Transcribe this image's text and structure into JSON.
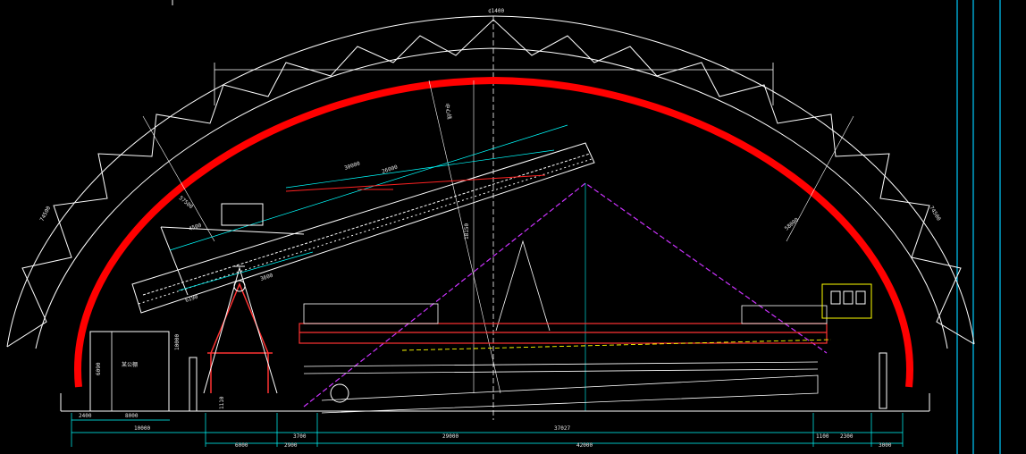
{
  "drawing": {
    "colors": {
      "background": "#000000",
      "roof_arch": "#ff0000",
      "structure": "#ffffff",
      "dimension": "#00ffff",
      "stockpile": "#cc33ff",
      "equipment_detail": "#ff00ff",
      "conveyor_marker": "#ff2222",
      "accent": "#ffff00",
      "frame_line": "#00ccff"
    },
    "annotations": {
      "top_span_dim": "¢1400",
      "shed_label": "某公棚",
      "shed_height": "6090",
      "boom_len_a": "30000",
      "boom_len_b": "26000",
      "boom_radius": "4500",
      "mast_width": "3600",
      "boom_seg": "6190",
      "pivot_height": "1110",
      "center_mark": "中心线",
      "mid_height": "18150",
      "left_arch_r": "74500",
      "right_arch_r": "74500",
      "inner_arch_r": "57500",
      "inner_arch_r2": "58000",
      "pillar_height": "10000"
    },
    "bottom_dims": {
      "row1": [
        "2400",
        "8000",
        "",
        "10000"
      ],
      "row2": [
        "3700",
        "29000",
        "37027",
        "1100",
        "2300"
      ],
      "row3": [
        "6000",
        "2900",
        "42000",
        "3000"
      ]
    }
  }
}
